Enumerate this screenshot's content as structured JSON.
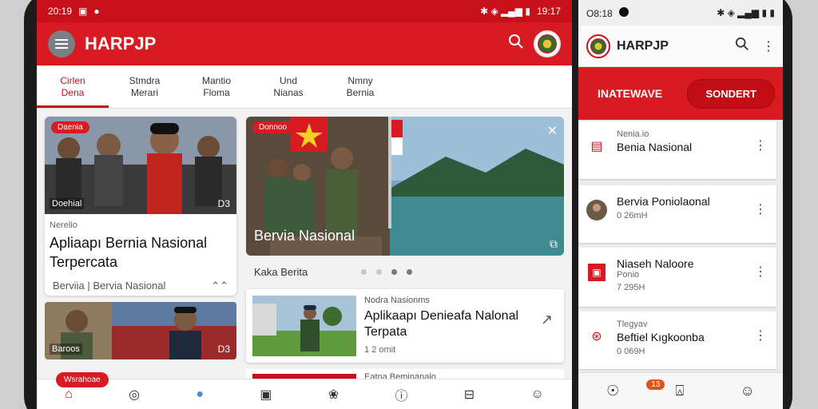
{
  "left_screen": {
    "status": {
      "time": "20:19",
      "right": "19:17"
    },
    "app": {
      "title": "HARPJP"
    },
    "tabs": [
      {
        "l1": "Cirlen",
        "l2": "Dena"
      },
      {
        "l1": "Stmdra",
        "l2": "Merari"
      },
      {
        "l1": "Mantio",
        "l2": "Floma"
      },
      {
        "l1": "Und",
        "l2": "Nianas"
      },
      {
        "l1": "Nmny",
        "l2": "Bernia"
      }
    ],
    "card_main": {
      "badge": "Daenia",
      "photo_label": "Doehial",
      "photo_icon": "D3",
      "meta": "Nerelio",
      "title_1": "Apliaapı Bernia Nasional",
      "title_2": "Terpercata",
      "foot": "Berviia  |  Bervia Nasional",
      "foot_icon": "⌃⌃"
    },
    "card_small": {
      "photo_label": "Baroos",
      "photo_icon": "D3"
    },
    "feature": {
      "badge": "Donnoo",
      "title": "Bervia Nasional",
      "close": "✕",
      "icon": "⧉"
    },
    "carousel": {
      "label": "Kaka Berita"
    },
    "card_right": {
      "kicker": "Nodra Nasionms",
      "title_1": "Aplikaapı Denieafa Nalonal",
      "title_2": "Terpata",
      "time": "1 2 omit",
      "chevron": "↗"
    },
    "card_right3": {
      "kicker": "Eatna Beminanalo"
    },
    "pill": "Wsrahoae",
    "bottomnav": [
      {
        "icon": "⌂",
        "label": ""
      },
      {
        "icon": "◎",
        "label": ""
      },
      {
        "icon": "●",
        "label": ""
      },
      {
        "icon": "▣",
        "label": ""
      },
      {
        "icon": "❀",
        "label": ""
      },
      {
        "icon": "ⓘ",
        "label": ""
      },
      {
        "icon": "⊟",
        "label": ""
      },
      {
        "icon": "☺",
        "label": ""
      }
    ]
  },
  "right_screen": {
    "status": {
      "time": "O8:18"
    },
    "app": {
      "title": "HARPJP"
    },
    "band": {
      "b1": "INATEWAVE",
      "b2": "SONDERT"
    },
    "list": [
      {
        "icon": "▤",
        "kicker": "Nenia.io",
        "title": "Benia Nasional",
        "time": ""
      },
      {
        "icon": "◉",
        "kicker": "",
        "title": "Bervia Poniolaonal",
        "time": "0 26mH"
      },
      {
        "icon": "▣",
        "kicker": "Niaseh Naloore",
        "title": "Ponio",
        "time": "7 295H"
      },
      {
        "icon": "⊛",
        "kicker": "Tlegyav",
        "title": "Beftiel Kıgkoonba",
        "time": "0 069H"
      }
    ],
    "nav_badge": "13",
    "bottomnav": [
      {
        "icon": "☉"
      },
      {
        "icon": "⍓"
      },
      {
        "icon": "☺"
      }
    ]
  }
}
